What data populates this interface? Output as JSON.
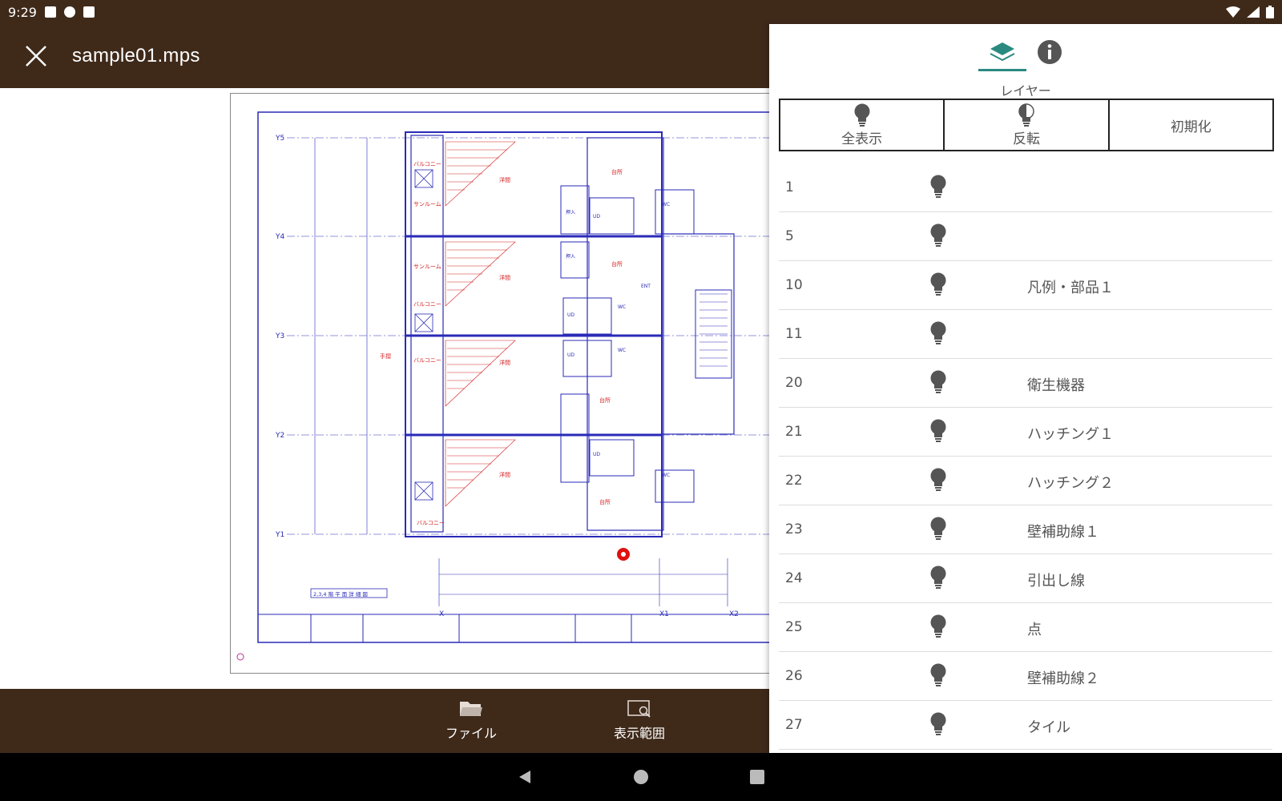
{
  "status_bar": {
    "time": "9:29"
  },
  "app_bar": {
    "title": "sample01.mps"
  },
  "bottom_nav": {
    "file_label": "ファイル",
    "view_range_label": "表示範囲"
  },
  "panel": {
    "heading": "レイヤー",
    "buttons": {
      "show_all": "全表示",
      "invert": "反転",
      "reset": "初期化"
    },
    "layers": [
      {
        "num": "1",
        "name": ""
      },
      {
        "num": "5",
        "name": ""
      },
      {
        "num": "10",
        "name": "凡例・部品１"
      },
      {
        "num": "11",
        "name": ""
      },
      {
        "num": "20",
        "name": "衛生機器"
      },
      {
        "num": "21",
        "name": "ハッチング１"
      },
      {
        "num": "22",
        "name": "ハッチング２"
      },
      {
        "num": "23",
        "name": "壁補助線１"
      },
      {
        "num": "24",
        "name": "引出し線"
      },
      {
        "num": "25",
        "name": "点"
      },
      {
        "num": "26",
        "name": "壁補助線２"
      },
      {
        "num": "27",
        "name": "タイル"
      }
    ]
  },
  "drawing": {
    "grid_y_labels": [
      "Y5",
      "Y4",
      "Y3",
      "Y2",
      "Y1"
    ],
    "grid_x_labels": [
      "X",
      "X1",
      "X2"
    ],
    "room_labels": [
      "バルコニー",
      "サンルーム",
      "サンルーム",
      "バルコニー",
      "バルコニー",
      "バルコニー",
      "洋間",
      "洋間",
      "洋間",
      "洋間",
      "台所",
      "台所",
      "台所",
      "台所",
      "押入",
      "押入",
      "UD",
      "UD",
      "UD",
      "UD",
      "WC",
      "WC",
      "WC",
      "WC",
      "ENT",
      "手摺"
    ],
    "title_block": "2,3,4 階 平 面 詳 細 図"
  },
  "colors": {
    "brand": "#3f2a1a",
    "accent": "#2a8a80",
    "plan_blue": "#2a2ab8",
    "plan_red": "#d42020"
  }
}
